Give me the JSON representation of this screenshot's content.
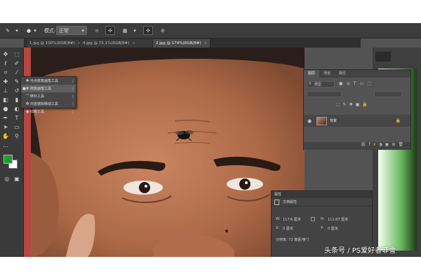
{
  "options_bar": {
    "mode_label": "模式:",
    "mode_value": "正常"
  },
  "document_tabs": [
    {
      "label": "1.jpg @ 100%(RGB/8#)",
      "close": "×"
    },
    {
      "label": "4.jpg @ 75.1%(RGB/8#)",
      "close": "×"
    },
    {
      "label": "2.jpg @ 174%(RGB/8#)",
      "close": "×"
    }
  ],
  "tool_flyout": {
    "items": [
      {
        "label": "污点修复画笔工具",
        "key": "J",
        "selected": false
      },
      {
        "label": "修复画笔工具",
        "key": "J",
        "selected": true
      },
      {
        "label": "修补工具",
        "key": "J",
        "selected": false
      },
      {
        "label": "内容感知移动工具",
        "key": "J",
        "selected": false
      },
      {
        "label": "红眼工具",
        "key": "J",
        "selected": false
      }
    ]
  },
  "layers_panel": {
    "tabs": [
      "图层",
      "通道",
      "路径"
    ],
    "kind_label": "类型",
    "layer_name": "背景"
  },
  "properties_panel": {
    "title": "属性",
    "subtitle": "文档属性",
    "w_label": "W:",
    "w_value": "117.6 厘米",
    "x_label": "X:",
    "x_value": "0 厘米",
    "h_label": "H:",
    "h_value": "111.67 厘米",
    "y_label": "Y:",
    "y_value": "0 厘米",
    "resolution": "分辨率: 72 像素/英寸"
  },
  "watermark": "头条号 / PS爱好者菲雪",
  "colors": {
    "foreground": "#1f9b2f",
    "background": "#ffffff",
    "ui_dark": "#3a3a3a",
    "ui_mid": "#535353"
  }
}
